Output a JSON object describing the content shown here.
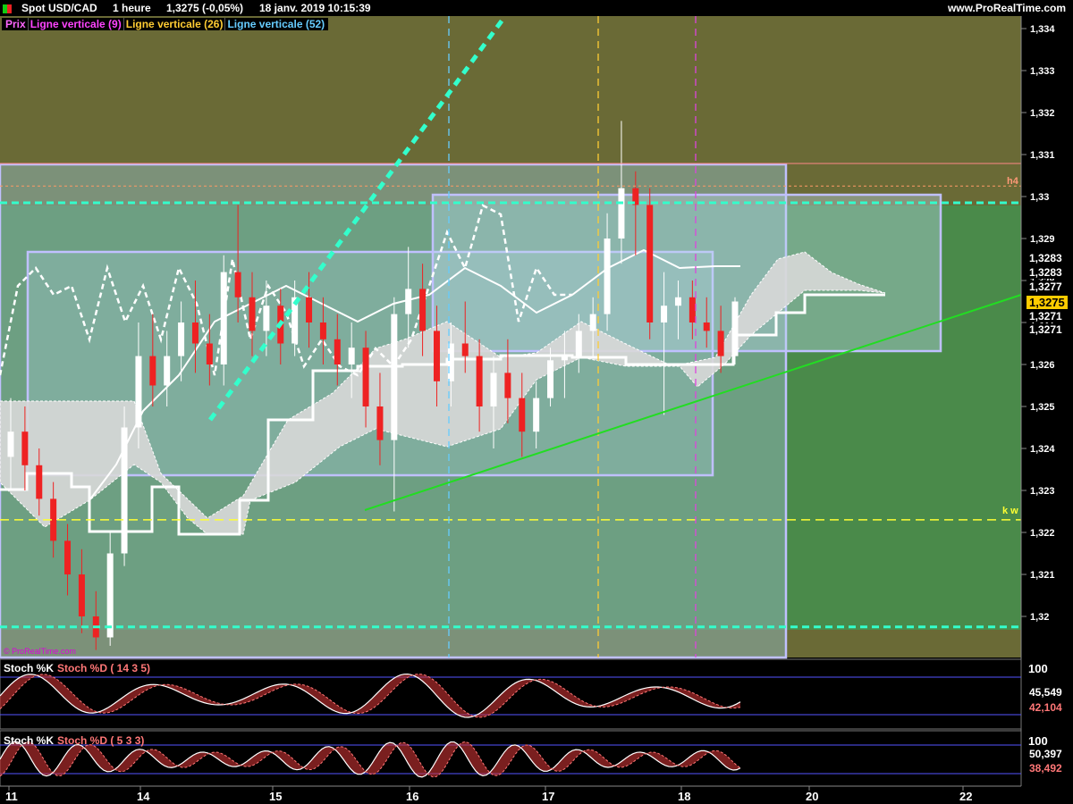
{
  "header": {
    "instrument": "Spot USD/CAD",
    "timeframe": "1 heure",
    "last_change": "1,3275 (-0,05%)",
    "datetime": "18 janv. 2019 10:15:39",
    "site": "www.ProRealTime.com"
  },
  "watermark": "© ProRealTime.com",
  "legend": [
    {
      "label": "Prix",
      "color": "#ff66ff"
    },
    {
      "label": "Ligne verticale (9)",
      "color": "#ff44ff"
    },
    {
      "label": "Ligne verticale (26)",
      "color": "#ffcc33"
    },
    {
      "label": "Ligne verticale (52)",
      "color": "#66ccff"
    }
  ],
  "price_tags": [
    {
      "text": "1,3283",
      "bg": "#000000",
      "fg": "#ffffff"
    },
    {
      "text": "1,3283",
      "bg": "#000000",
      "fg": "#ffffff"
    },
    {
      "text": "1,3277",
      "bg": "#000000",
      "fg": "#ffffff"
    },
    {
      "text": "1,3275",
      "bg": "#ffcc00",
      "fg": "#000000"
    },
    {
      "text": "1,3271",
      "bg": "#000000",
      "fg": "#ffffff"
    },
    {
      "text": "1,3271",
      "bg": "#000000",
      "fg": "#ffffff"
    }
  ],
  "markers": {
    "h4": "h4",
    "kw": "k w"
  },
  "panels": [
    {
      "labels": [
        {
          "text": "Stoch %K",
          "color": "#ffffff"
        },
        {
          "text": "Stoch %D ( 14 3 5)",
          "color": "#ff7777"
        }
      ],
      "top": "100",
      "k_value": "45,549",
      "d_value": "42,104"
    },
    {
      "labels": [
        {
          "text": "Stoch %K",
          "color": "#ffffff"
        },
        {
          "text": "Stoch %D ( 5 3 3)",
          "color": "#ff7777"
        }
      ],
      "top": "100",
      "k_value": "50,397",
      "d_value": "38,492"
    }
  ],
  "colors": {
    "bull": "#ffffff",
    "bear": "#ee2222",
    "cloud": "#d8d8d8",
    "green_bg": "#4a8a4a",
    "olive_bg": "#6a6a36",
    "accent": "#33ffcc",
    "trend": "#22dd22"
  },
  "chart_data": {
    "type": "candlestick",
    "instrument": "Spot USD/CAD",
    "y_ticks": [
      "1,334",
      "1,333",
      "1,332",
      "1,331",
      "1,33",
      "1,329",
      "1,328",
      "1,327",
      "1,326",
      "1,325",
      "1,324",
      "1,323",
      "1,322",
      "1,321",
      "1,32"
    ],
    "ylim": [
      1.3192,
      1.3345
    ],
    "x_ticks": [
      "11",
      "14",
      "15",
      "16",
      "17",
      "18",
      "20",
      "22"
    ],
    "last_price": 1.3275,
    "horizontal_levels": [
      {
        "name": "h4",
        "value": 1.33025
      },
      {
        "name": "k w",
        "value": 1.3223
      },
      {
        "name": "upper band",
        "value": 1.32985
      },
      {
        "name": "lower band",
        "value": 1.31975
      }
    ],
    "candles": [
      [
        1.3238,
        1.3252,
        1.323,
        1.3244
      ],
      [
        1.3244,
        1.325,
        1.323,
        1.3236
      ],
      [
        1.3236,
        1.324,
        1.3224,
        1.3228
      ],
      [
        1.3228,
        1.3232,
        1.3214,
        1.3218
      ],
      [
        1.3218,
        1.3222,
        1.3205,
        1.321
      ],
      [
        1.321,
        1.3216,
        1.3196,
        1.32
      ],
      [
        1.32,
        1.3206,
        1.3192,
        1.3195
      ],
      [
        1.3195,
        1.322,
        1.3193,
        1.3215
      ],
      [
        1.3215,
        1.325,
        1.3212,
        1.3245
      ],
      [
        1.3245,
        1.327,
        1.324,
        1.3262
      ],
      [
        1.3262,
        1.3272,
        1.325,
        1.3255
      ],
      [
        1.3255,
        1.3268,
        1.325,
        1.3262
      ],
      [
        1.3262,
        1.3275,
        1.3256,
        1.327
      ],
      [
        1.327,
        1.328,
        1.3258,
        1.3265
      ],
      [
        1.3265,
        1.3272,
        1.3255,
        1.326
      ],
      [
        1.326,
        1.3286,
        1.3255,
        1.3282
      ],
      [
        1.3282,
        1.3298,
        1.327,
        1.3276
      ],
      [
        1.3276,
        1.3282,
        1.3262,
        1.3268
      ],
      [
        1.3268,
        1.328,
        1.3262,
        1.3274
      ],
      [
        1.3274,
        1.3278,
        1.326,
        1.3265
      ],
      [
        1.3265,
        1.328,
        1.3262,
        1.3276
      ],
      [
        1.3276,
        1.3282,
        1.3264,
        1.327
      ],
      [
        1.327,
        1.3276,
        1.326,
        1.3266
      ],
      [
        1.3266,
        1.3272,
        1.3255,
        1.326
      ],
      [
        1.326,
        1.327,
        1.3252,
        1.3264
      ],
      [
        1.3264,
        1.3268,
        1.3245,
        1.325
      ],
      [
        1.325,
        1.3258,
        1.3236,
        1.3242
      ],
      [
        1.3242,
        1.3276,
        1.3225,
        1.3272
      ],
      [
        1.3272,
        1.3288,
        1.3264,
        1.3278
      ],
      [
        1.3278,
        1.3284,
        1.3262,
        1.3268
      ],
      [
        1.3268,
        1.3274,
        1.325,
        1.3256
      ],
      [
        1.3256,
        1.327,
        1.325,
        1.3265
      ],
      [
        1.3265,
        1.3275,
        1.3258,
        1.3262
      ],
      [
        1.3262,
        1.3266,
        1.3244,
        1.325
      ],
      [
        1.325,
        1.3262,
        1.324,
        1.3258
      ],
      [
        1.3258,
        1.3266,
        1.3246,
        1.3252
      ],
      [
        1.3252,
        1.3258,
        1.3238,
        1.3244
      ],
      [
        1.3244,
        1.3256,
        1.324,
        1.3252
      ],
      [
        1.3252,
        1.3264,
        1.325,
        1.3261
      ],
      [
        1.3261,
        1.3268,
        1.3252,
        1.3262
      ],
      [
        1.3262,
        1.3272,
        1.3258,
        1.3268
      ],
      [
        1.3268,
        1.3276,
        1.3262,
        1.3272
      ],
      [
        1.3272,
        1.3296,
        1.3268,
        1.329
      ],
      [
        1.329,
        1.3318,
        1.3284,
        1.3302
      ],
      [
        1.3302,
        1.3306,
        1.3286,
        1.3298
      ],
      [
        1.3298,
        1.3302,
        1.3266,
        1.327
      ],
      [
        1.327,
        1.3282,
        1.3248,
        1.3274
      ],
      [
        1.3274,
        1.328,
        1.3266,
        1.3276
      ],
      [
        1.3276,
        1.328,
        1.3266,
        1.327
      ],
      [
        1.327,
        1.3276,
        1.3264,
        1.3268
      ],
      [
        1.3268,
        1.3274,
        1.3258,
        1.3262
      ],
      [
        1.3262,
        1.3276,
        1.326,
        1.3275
      ]
    ],
    "series": [
      {
        "name": "Prix",
        "values": []
      }
    ]
  }
}
